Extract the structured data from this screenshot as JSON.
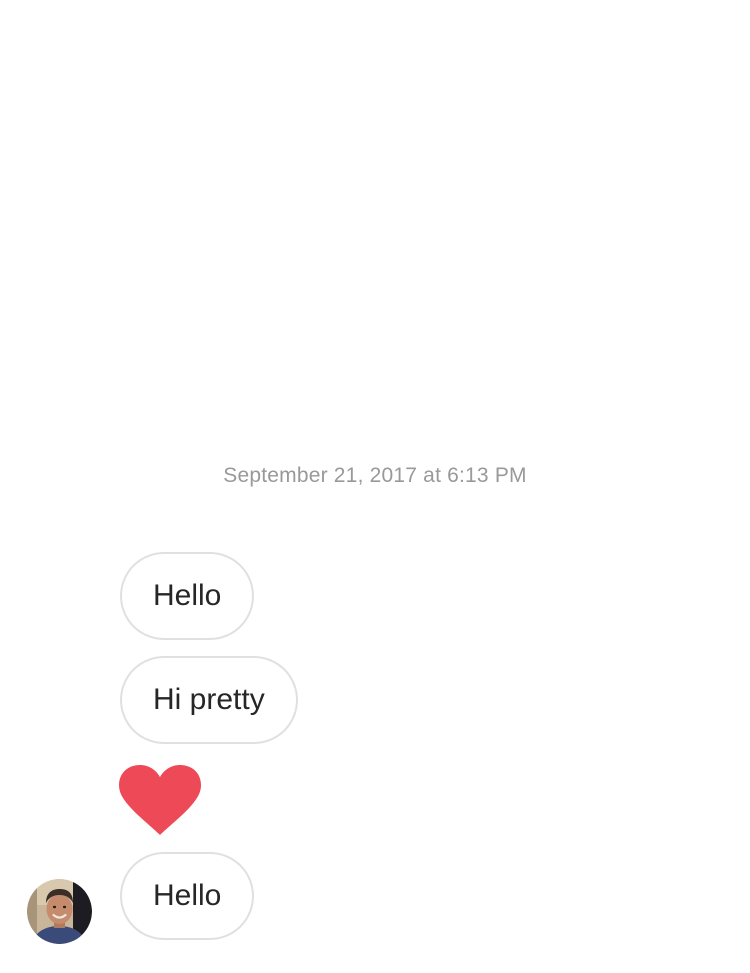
{
  "thread": {
    "timestamp": "September 21, 2017 at 6:13 PM",
    "messages": [
      {
        "type": "text",
        "text": "Hello"
      },
      {
        "type": "text",
        "text": "Hi pretty"
      },
      {
        "type": "like",
        "icon": "heart-icon",
        "color": "#ed4956"
      },
      {
        "type": "text",
        "text": "Hello"
      }
    ],
    "sender_avatar": {
      "icon": "avatar"
    }
  }
}
